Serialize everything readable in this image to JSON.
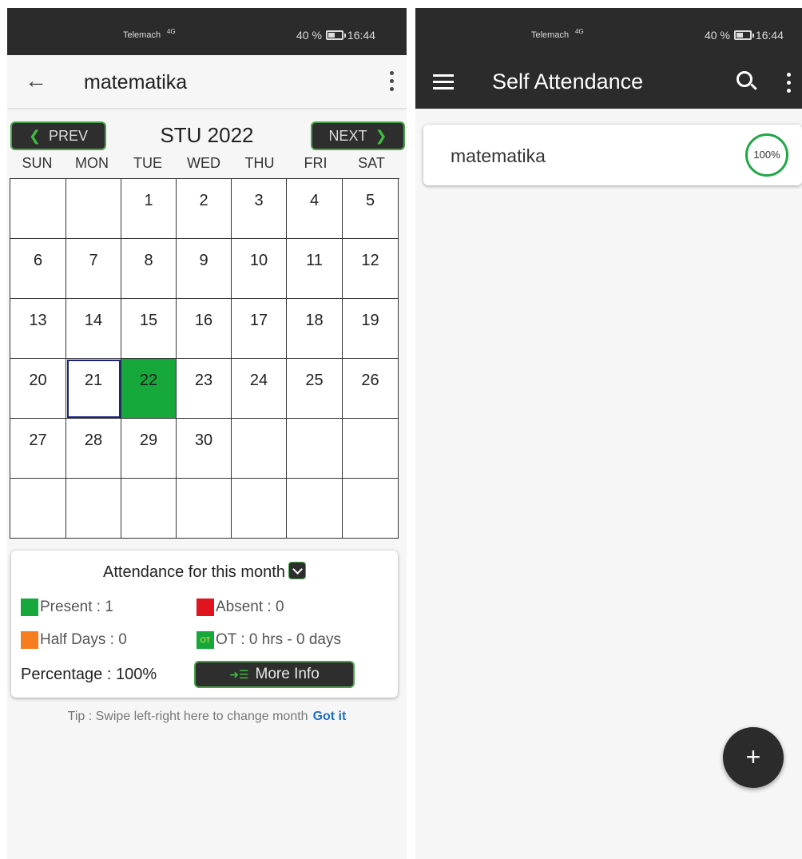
{
  "left": {
    "status": {
      "carrier": "Telemach",
      "signal": "4G",
      "battery": "40 %",
      "time": "16:44"
    },
    "appbar": {
      "title": "matematika"
    },
    "calendar": {
      "prev_label": "PREV",
      "next_label": "NEXT",
      "month": "STU 2022",
      "weekdays": [
        "SUN",
        "MON",
        "TUE",
        "WED",
        "THU",
        "FRI",
        "SAT"
      ],
      "cells": [
        "",
        "",
        "1",
        "2",
        "3",
        "4",
        "5",
        "6",
        "7",
        "8",
        "9",
        "10",
        "11",
        "12",
        "13",
        "14",
        "15",
        "16",
        "17",
        "18",
        "19",
        "20",
        "21",
        "22",
        "23",
        "24",
        "25",
        "26",
        "27",
        "28",
        "29",
        "30",
        "",
        "",
        "",
        "",
        "",
        "",
        "",
        "",
        "",
        ""
      ],
      "today": "21",
      "present_days": [
        "22"
      ]
    },
    "summary": {
      "heading": "Attendance for this month",
      "present": "Present : 1",
      "absent": "Absent : 0",
      "half_days": "Half Days : 0",
      "ot_badge": "OT",
      "ot": "OT : 0 hrs - 0 days",
      "percentage": "Percentage : 100%",
      "more_info": "More Info"
    },
    "tip": {
      "text": "Tip : Swipe left-right here to change month",
      "action": "Got it"
    },
    "colors": {
      "present": "#16a83a",
      "absent": "#e0141e",
      "half_day": "#f57c1f",
      "accent": "#4aa34a"
    }
  },
  "right": {
    "status": {
      "carrier": "Telemach",
      "signal": "4G",
      "battery": "40 %",
      "time": "16:44"
    },
    "appbar": {
      "title": "Self Attendance"
    },
    "subjects": [
      {
        "name": "matematika",
        "percent": "100%"
      }
    ],
    "fab": "+"
  }
}
